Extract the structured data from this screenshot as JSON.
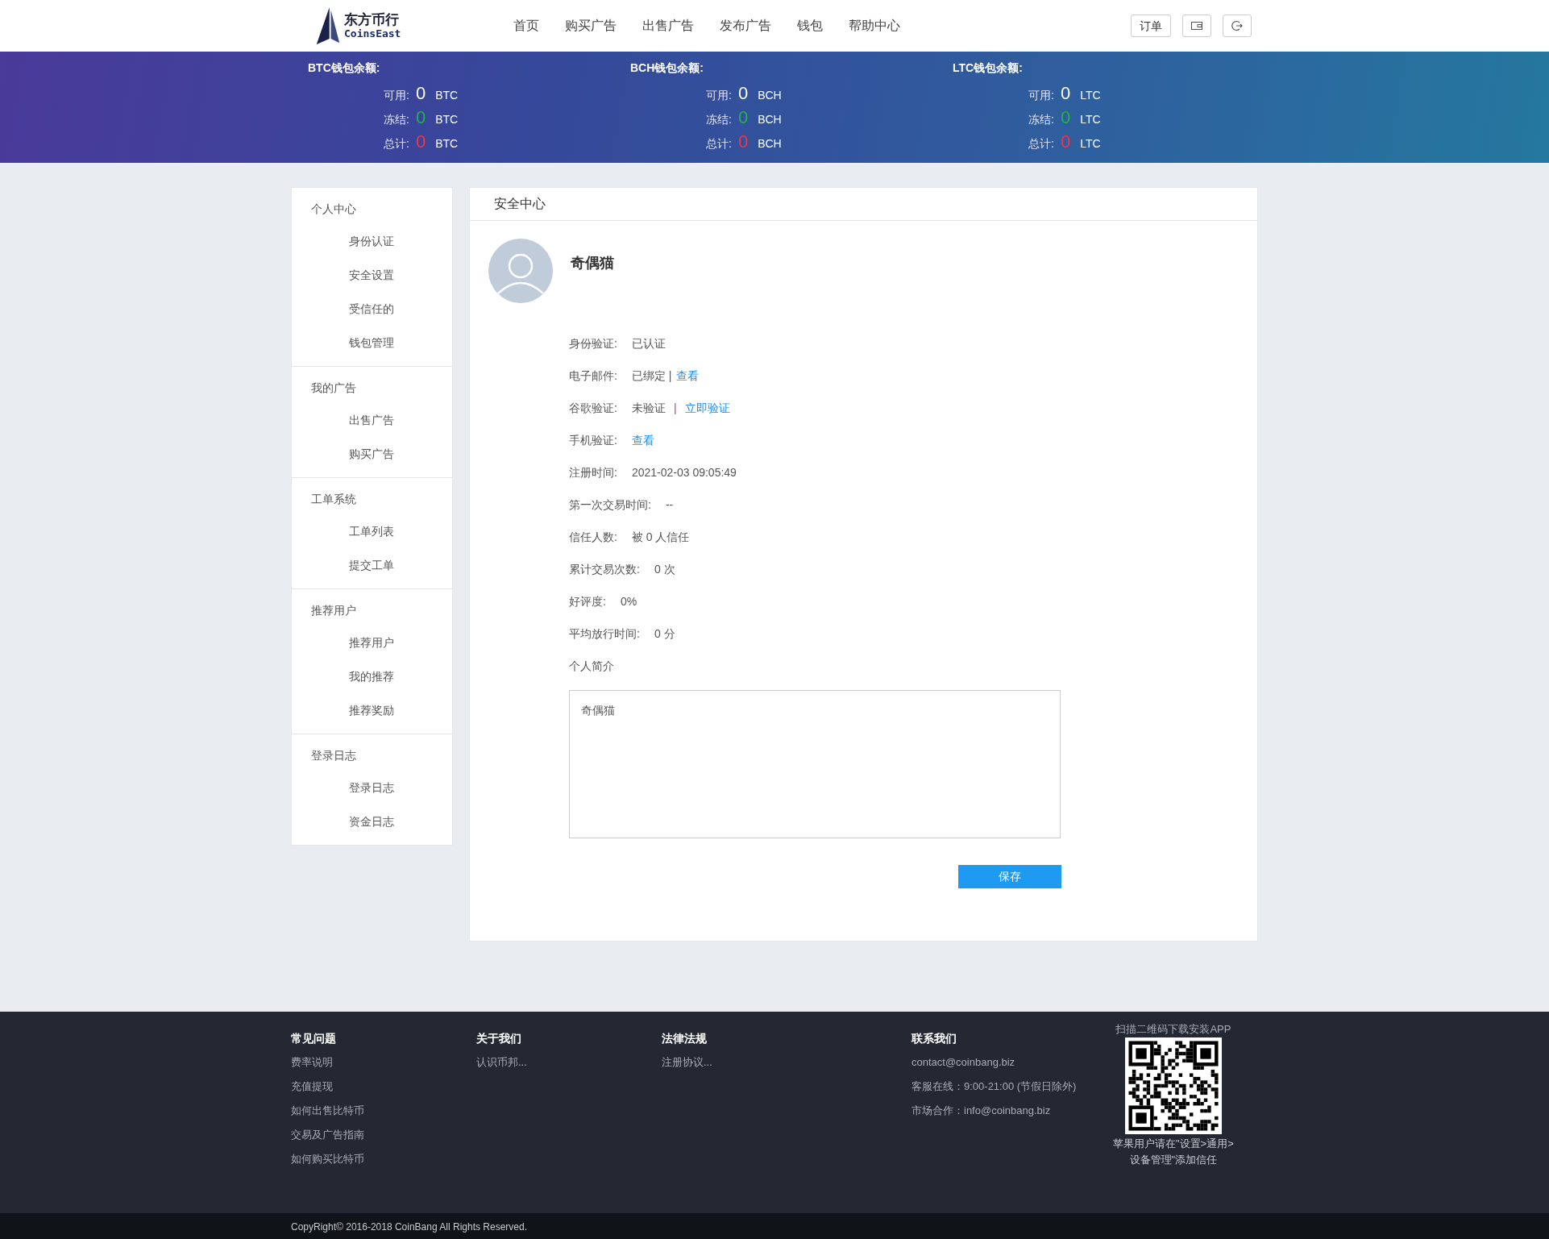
{
  "header": {
    "logo": {
      "name": "东方币行",
      "subtitle": "CoinsEast"
    },
    "nav": [
      {
        "label": "首页"
      },
      {
        "label": "购买广告"
      },
      {
        "label": "出售广告"
      },
      {
        "label": "发布广告"
      },
      {
        "label": "钱包"
      },
      {
        "label": "帮助中心"
      }
    ],
    "buttons": [
      {
        "kind": "text",
        "label": "订单"
      },
      {
        "kind": "wallet"
      },
      {
        "kind": "logout"
      }
    ]
  },
  "wallets": [
    {
      "title": "BTC钱包余额:",
      "rows": [
        {
          "kind": "available",
          "label": "可用:",
          "value": "0",
          "unit": "BTC"
        },
        {
          "kind": "frozen",
          "label": "冻结:",
          "value": "0",
          "unit": "BTC"
        },
        {
          "kind": "total",
          "label": "总计:",
          "value": "0",
          "unit": "BTC"
        }
      ]
    },
    {
      "title": "BCH钱包余额:",
      "rows": [
        {
          "kind": "available",
          "label": "可用:",
          "value": "0",
          "unit": "BCH"
        },
        {
          "kind": "frozen",
          "label": "冻结:",
          "value": "0",
          "unit": "BCH"
        },
        {
          "kind": "total",
          "label": "总计:",
          "value": "0",
          "unit": "BCH"
        }
      ]
    },
    {
      "title": "LTC钱包余额:",
      "rows": [
        {
          "kind": "available",
          "label": "可用:",
          "value": "0",
          "unit": "LTC"
        },
        {
          "kind": "frozen",
          "label": "冻结:",
          "value": "0",
          "unit": "LTC"
        },
        {
          "kind": "total",
          "label": "总计:",
          "value": "0",
          "unit": "LTC"
        }
      ]
    }
  ],
  "sidebar": [
    {
      "title": "个人中心",
      "items": [
        {
          "label": "身份认证"
        },
        {
          "label": "安全设置"
        },
        {
          "label": "受信任的"
        },
        {
          "label": "钱包管理"
        }
      ]
    },
    {
      "title": "我的广告",
      "items": [
        {
          "label": "出售广告"
        },
        {
          "label": "购买广告"
        }
      ]
    },
    {
      "title": "工单系统",
      "items": [
        {
          "label": "工单列表"
        },
        {
          "label": "提交工单"
        }
      ]
    },
    {
      "title": "推荐用户",
      "items": [
        {
          "label": "推荐用户"
        },
        {
          "label": "我的推荐"
        },
        {
          "label": "推荐奖励"
        }
      ]
    },
    {
      "title": "登录日志",
      "items": [
        {
          "label": "登录日志"
        },
        {
          "label": "资金日志"
        }
      ]
    }
  ],
  "panel": {
    "title": "安全中心",
    "username": "奇偶猫",
    "fields": [
      {
        "label": "身份验证:",
        "value": "已认证"
      },
      {
        "label": "电子邮件:",
        "value": "已绑定 |",
        "link": "查看"
      },
      {
        "label": "谷歌验证:",
        "value": "未验证",
        "separator": "|",
        "link": "立即验证"
      },
      {
        "label": "手机验证:",
        "link": "查看"
      },
      {
        "label": "注册时间:",
        "value": "2021-02-03 09:05:49"
      },
      {
        "label": "第一次交易时间:",
        "value": "--"
      },
      {
        "label": "信任人数:",
        "value": "被 0 人信任"
      },
      {
        "label": "累计交易次数:",
        "value": "0 次"
      },
      {
        "label": "好评度:",
        "value": "0%"
      },
      {
        "label": "平均放行时间:",
        "value": "0 分"
      }
    ],
    "bio_label": "个人简介",
    "bio": "奇偶猫",
    "save": "保存"
  },
  "footer": {
    "columns": [
      {
        "title": "常见问题",
        "links": [
          "费率说明",
          "充值提现",
          "如何出售比特币",
          "交易及广告指南",
          "如何购买比特币"
        ]
      },
      {
        "title": "关于我们",
        "links": [
          "认识币邦..."
        ]
      },
      {
        "title": "法律法规",
        "links": [
          "注册协议..."
        ]
      }
    ],
    "contact": {
      "title": "联系我们",
      "lines": [
        "contact@coinbang.biz",
        "客服在线：9:00-21:00 (节假日除外)",
        "市场合作：info@coinbang.biz"
      ]
    },
    "app": {
      "caption": "扫描二维码下载安装APP",
      "note_lines": [
        "苹果用户请在\"设置>通用>",
        "设备管理\"添加信任"
      ]
    },
    "copyright": "CopyRight© 2016-2018 CoinBang All Rights Reserved."
  }
}
